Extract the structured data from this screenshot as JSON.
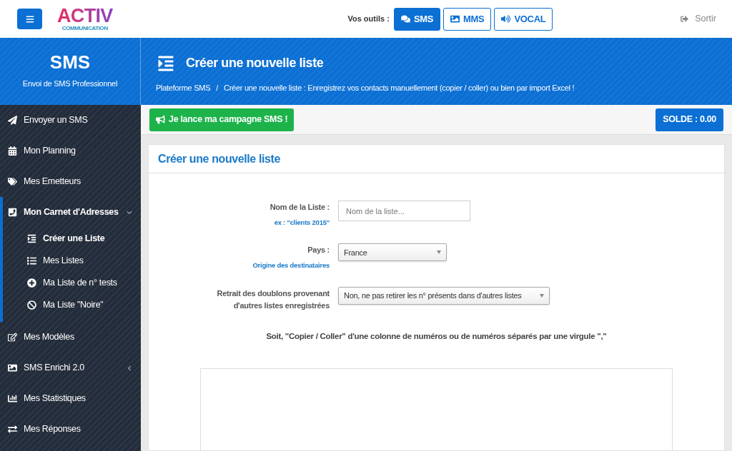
{
  "logo": {
    "name": "ACTIV",
    "tagline": "COMMUNICATION"
  },
  "tools": {
    "label": "Vos outils :",
    "items": [
      {
        "label": "SMS",
        "kind": "sms",
        "selected": true
      },
      {
        "label": "MMS",
        "kind": "mms",
        "selected": false
      },
      {
        "label": "VOCAL",
        "kind": "vocal",
        "selected": false
      }
    ]
  },
  "logout": "Sortir",
  "brand": {
    "title": "SMS",
    "subtitle": "Envoi de SMS Professionnel"
  },
  "page_header": {
    "title": "Créer une nouvelle liste",
    "breadcrumb": [
      {
        "label": "Plateforme SMS",
        "separator": "/"
      },
      {
        "label": "Créer une nouvelle liste : Enregistrez vos contacts manuellement (copier / coller) ou bien par import Excel !"
      }
    ]
  },
  "sidebar": {
    "items": [
      {
        "label": "Envoyer un SMS",
        "selected": false
      },
      {
        "label": "Mon Planning",
        "selected": false
      },
      {
        "label": "Mes Emetteurs",
        "selected": false
      },
      {
        "label": "Mon Carnet d'Adresses",
        "selected": true,
        "expanded": true,
        "children": [
          {
            "label": "Créer une Liste",
            "selected": true
          },
          {
            "label": "Mes Listes",
            "selected": false
          },
          {
            "label": "Ma Liste de n° tests",
            "selected": false
          },
          {
            "label": "Ma Liste \"Noire\"",
            "selected": false
          }
        ]
      },
      {
        "label": "Mes Modèles",
        "selected": false
      },
      {
        "label": "SMS Enrichi 2.0",
        "selected": false,
        "expanded": false
      },
      {
        "label": "Mes Statistiques",
        "selected": false
      },
      {
        "label": "Mes Réponses",
        "selected": false
      }
    ]
  },
  "campaign_button": "Je lance ma campagne SMS !",
  "balance": "SOLDE : 0.00",
  "form": {
    "title": "Créer une nouvelle liste",
    "fields": [
      {
        "kind": "text",
        "label": "Nom de la Liste :",
        "hint": "ex : \"clients 2015\"",
        "placeholder": "Nom de la liste..."
      },
      {
        "kind": "select",
        "label": "Pays :",
        "hint": "Origine des destinataires",
        "value": "France"
      },
      {
        "kind": "select",
        "label": "Retrait des doublons provenant d'autres listes enregistrées",
        "value": "Non, ne pas retirer les n° présents dans d'autres listes"
      }
    ],
    "instruction": "Soit, \"Copier / Coller\" d'une colonne de numéros ou de numéros séparés par une virgule \",\""
  }
}
